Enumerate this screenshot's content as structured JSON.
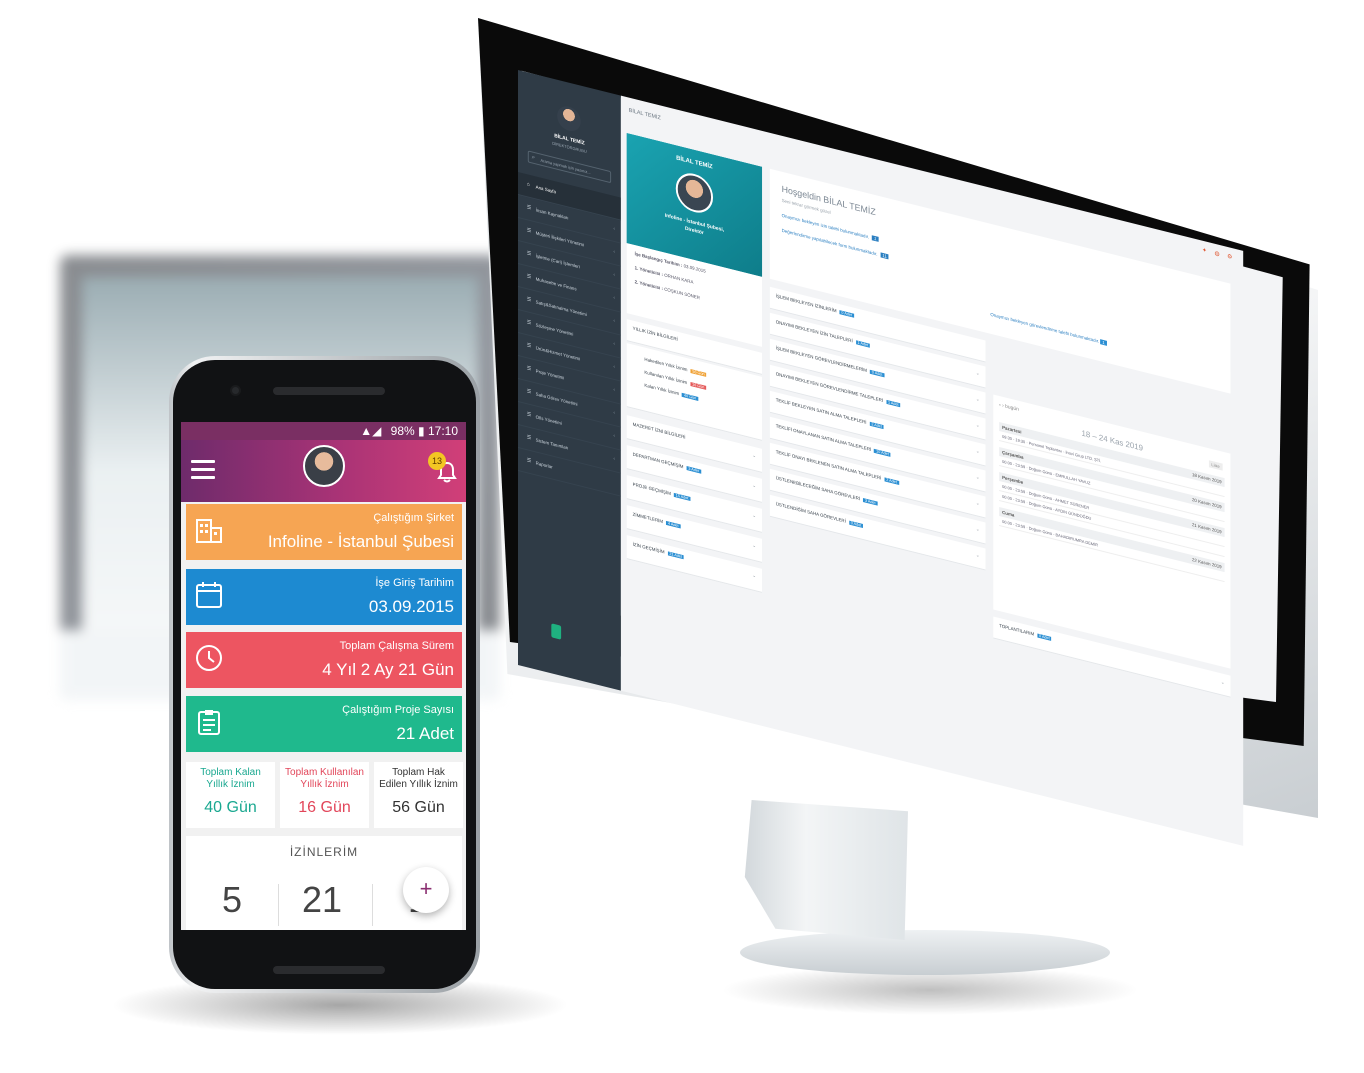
{
  "desktop": {
    "sidebar": {
      "user_name": "BİLAL TEMİZ",
      "user_role": "DİREKTÖRGRUBU",
      "search_placeholder": "Arama yapmak için yazınız...",
      "menu": [
        {
          "label": "Ana Sayfa",
          "icon": "home-icon"
        },
        {
          "label": "İnsan Kaynakları",
          "icon": "users-icon"
        },
        {
          "label": "Müşteri İlişkileri Yönetimi",
          "icon": "contacts-icon"
        },
        {
          "label": "İşletme (Cari) İşlemleri",
          "icon": "briefcase-icon"
        },
        {
          "label": "Muhasebe ve Finans",
          "icon": "finance-icon"
        },
        {
          "label": "Satış&Satınalma Yönetimi",
          "icon": "cart-icon"
        },
        {
          "label": "Sözleşme Yönetimi",
          "icon": "contract-icon"
        },
        {
          "label": "Ürün&Hizmet Yönetimi",
          "icon": "product-icon"
        },
        {
          "label": "Proje Yönetimi",
          "icon": "project-icon"
        },
        {
          "label": "Saha Görev Yönetimi",
          "icon": "field-icon"
        },
        {
          "label": "Ofis Yönetimi",
          "icon": "office-icon"
        },
        {
          "label": "Sistem Tanımları",
          "icon": "settings-icon"
        },
        {
          "label": "Raporlar",
          "icon": "report-icon"
        }
      ]
    },
    "breadcrumb": "BİLAL TEMİZ",
    "profile": {
      "name": "BİLAL TEMİZ",
      "branch": "Infoline - İstanbul Şubesi,",
      "role": "Direktör",
      "start_date_label": "İşe Başlangıç Tarihim :",
      "start_date": "03.09.2015",
      "manager1_label": "1. Yöneticisi :",
      "manager1": "ORHAN KARA",
      "manager2_label": "2. Yöneticisi :",
      "manager2": "COŞKUN SÖNER"
    },
    "welcome": {
      "title": "Hoşgeldin BİLAL TEMİZ",
      "subtitle": "Seni tekrar görmek güzel",
      "line1": "Onaymızı bekleyen izin talebi bulunmaktadır.",
      "line1_badge": "1",
      "line2": "Değerlendirme yapılabilecek form bulunmaktadır.",
      "line2_badge": "11",
      "line3": "Onaymızı bekleyen görevlendirme talebi bulunmaktadır.",
      "line3_badge": "1"
    },
    "left_panels": [
      {
        "title": "YILLIK İZİN BİLGİLERİ"
      },
      {
        "title": "Hakedilen Yıllık İzinim",
        "badge": "56 Gün",
        "color": "orange"
      },
      {
        "title": "Kullanılan Yıllık İzinim",
        "badge": "16 Gün",
        "color": "red"
      },
      {
        "title": "Kalan Yıllık İzinim",
        "badge": "40 Gün",
        "color": "blue"
      },
      {
        "title": "MAZERET İZNİ BİLGİLERİ"
      },
      {
        "title": "DEPARTMAN GEÇMİŞİM",
        "badge": "3 Adet"
      },
      {
        "title": "PROJE GEÇMİŞİM",
        "badge": "15 Adet"
      },
      {
        "title": "ZİMMETLERİM",
        "badge": "4 Adet"
      },
      {
        "title": "İZİN GEÇMİŞİM",
        "badge": "21 Adet"
      }
    ],
    "mid_panels": [
      {
        "title": "İŞLEM BEKLEYEN İZİNLERİM",
        "badge": "0 Adet"
      },
      {
        "title": "ONAYIMI BEKLEYEN İZİN TALEPLERİ",
        "badge": "1 Adet"
      },
      {
        "title": "İŞLEM BEKLEYEN GÖREVLENDİRMELERİM",
        "badge": "0 Adet"
      },
      {
        "title": "ONAYIMI BEKLEYEN GÖREVLENDİRME TALEPLERİ",
        "badge": "1 Adet"
      },
      {
        "title": "TEKLİF BEKLEYEN SATIN ALMA TALEPLERİ",
        "badge": "2 Adet"
      },
      {
        "title": "TEKLİFİ ONAYLANAN SATIN ALMA TALEPLERİ",
        "badge": "10 Adet"
      },
      {
        "title": "TEKLİF ONAYI BEKLENEN SATIN ALMA TALEPLERİ",
        "badge": "2 Adet"
      },
      {
        "title": "ÜSTLENEBİLECEĞİM SAHA GÖREVLERİ",
        "badge": "3 Adet"
      },
      {
        "title": "ÜSTLENDİĞİM SAHA GÖREVLERİ",
        "badge": "0 Adet"
      }
    ],
    "calendar": {
      "nav_today": "bugün",
      "range": "18 – 24 Kas 2019",
      "view": "Liste",
      "days": [
        {
          "day": "Pazartesi",
          "date": "18 Kasım 2019",
          "events": [
            {
              "time": "09:30 - 19:30",
              "text": "Personel Toplantısı - İnoví Grup LTD. ŞTİ."
            }
          ]
        },
        {
          "day": "Çarşamba",
          "date": "20 Kasım 2019",
          "events": [
            {
              "time": "00:00 - 23:59",
              "text": "Doğum Günü - EMRULLAH YAVUZ"
            }
          ]
        },
        {
          "day": "Perşembe",
          "date": "21 Kasım 2019",
          "events": [
            {
              "time": "00:00 - 23:59",
              "text": "Doğum Günü - AHMET SÜRENER"
            },
            {
              "time": "00:00 - 23:59",
              "text": "Doğum Günü - AYDIN GÜNDOĞDU"
            }
          ]
        },
        {
          "day": "Cuma",
          "date": "22 Kasım 2019",
          "events": [
            {
              "time": "00:00 - 23:59",
              "text": "Doğum Günü - BAHADIRUMRA DEMİR"
            }
          ]
        }
      ]
    },
    "meetings": {
      "title": "TOPLANTILARIM",
      "badge": "0 Adet"
    }
  },
  "mobile": {
    "status": {
      "battery": "98%",
      "time": "17:10"
    },
    "notifications": "13",
    "tiles": [
      {
        "label": "Çalıştığım Şirket",
        "value": "Infoline - İstanbul Şubesi",
        "icon": "building-icon"
      },
      {
        "label": "İşe Giriş Tarihim",
        "value": "03.09.2015",
        "icon": "calendar-icon"
      },
      {
        "label": "Toplam Çalışma Sürem",
        "value": "4 Yıl 2 Ay 21 Gün",
        "icon": "clock-icon"
      },
      {
        "label": "Çalıştığım Proje Sayısı",
        "value": "21 Adet",
        "icon": "clipboard-icon"
      }
    ],
    "stats": [
      {
        "label": "Toplam Kalan Yıllık İznim",
        "value": "40 Gün"
      },
      {
        "label": "Toplam Kullanılan Yıllık İznim",
        "value": "16 Gün"
      },
      {
        "label": "Toplam Hak Edilen Yıllık İznim",
        "value": "56 Gün"
      }
    ],
    "leaves": {
      "title": "İZİNLERİM",
      "values": [
        "5",
        "21",
        "1"
      ]
    },
    "fab": "+"
  },
  "colors": {
    "orange": "#f6a553",
    "blue": "#1d8ad1",
    "red": "#ed5561",
    "green": "#1fb98d",
    "purple": "#7a2f63",
    "sidebar": "#2f3b46",
    "teal": "#1698a6"
  }
}
